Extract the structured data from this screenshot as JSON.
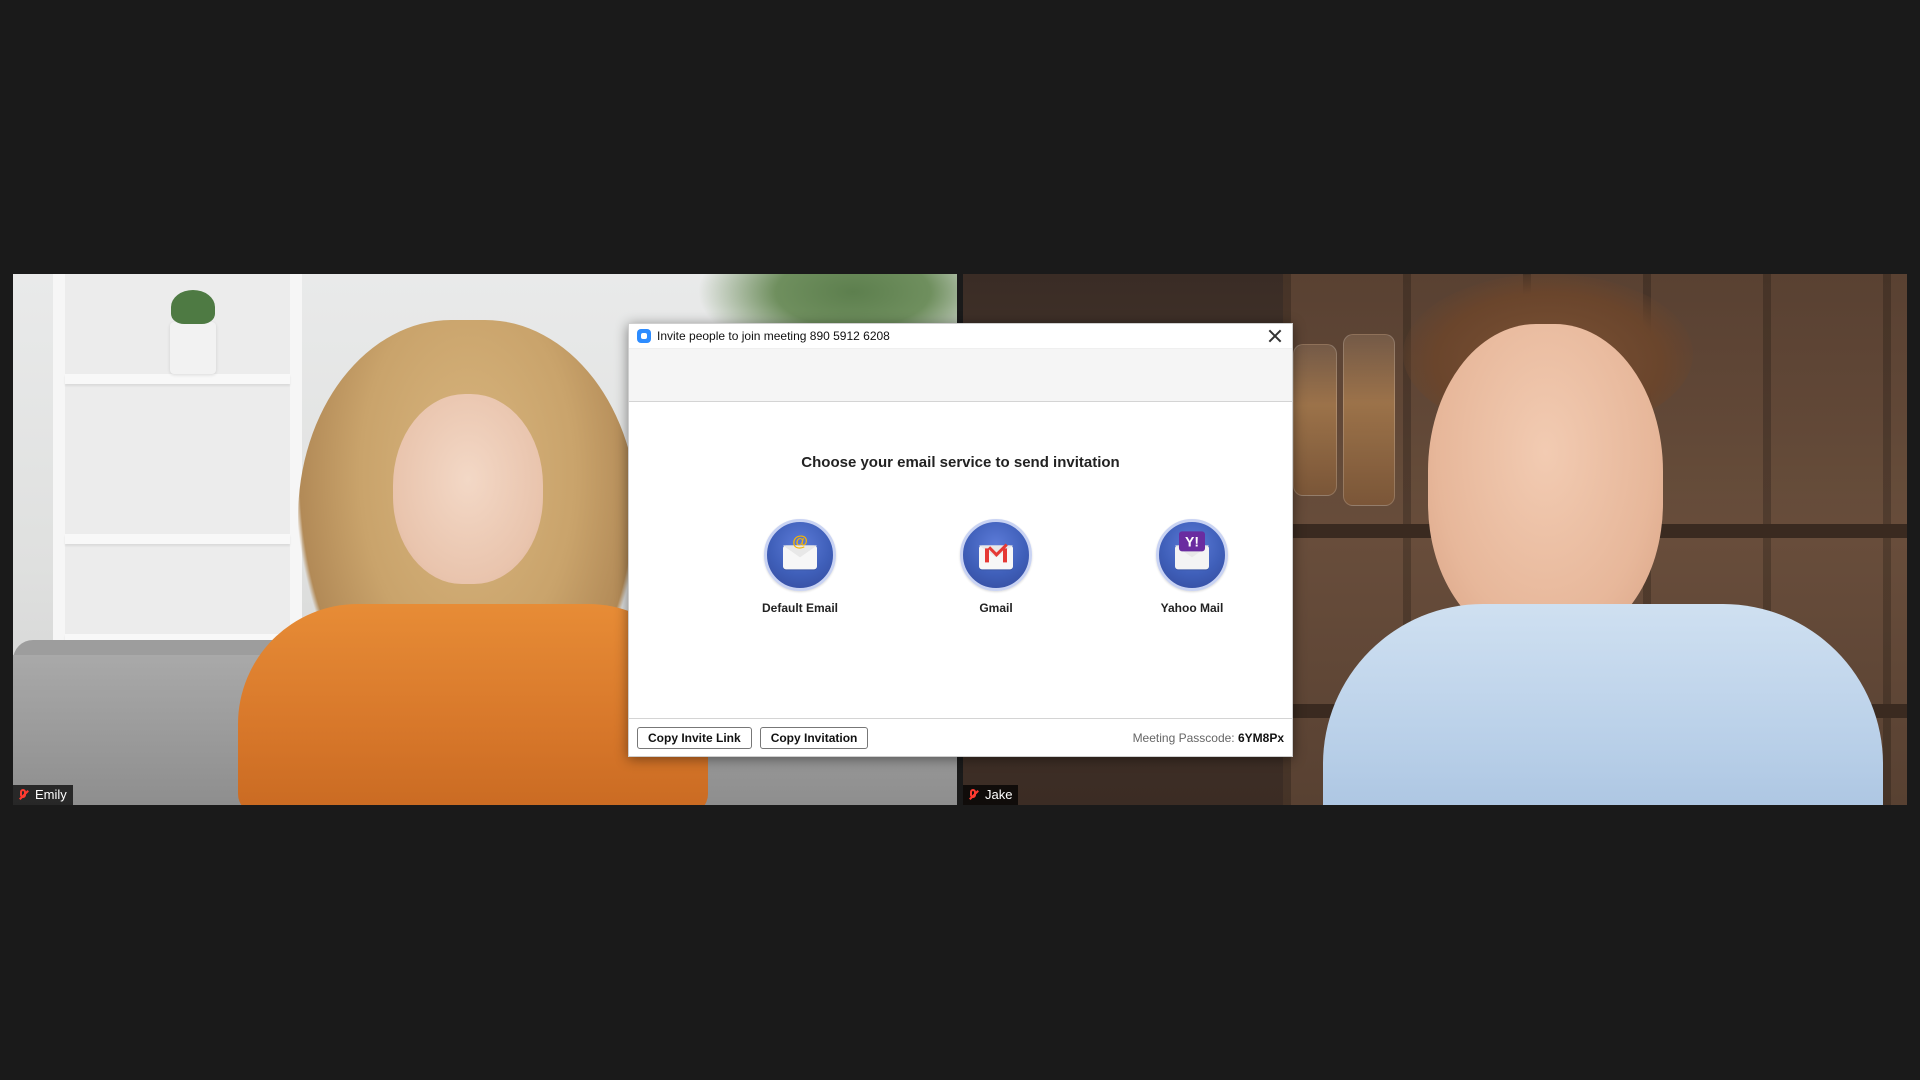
{
  "participants": [
    {
      "name": "Emily",
      "mic_state": "muted"
    },
    {
      "name": "Jake",
      "mic_state": "muted"
    }
  ],
  "dialog": {
    "title": "Invite people to join meeting 890 5912 6208",
    "headline": "Choose your email service to send invitation",
    "providers": [
      {
        "label": "Default Email",
        "icon": "email-envelope-icon"
      },
      {
        "label": "Gmail",
        "icon": "gmail-icon"
      },
      {
        "label": "Yahoo Mail",
        "icon": "yahoo-mail-icon"
      }
    ],
    "footer": {
      "copy_invite_link_label": "Copy Invite Link",
      "copy_invitation_label": "Copy Invitation",
      "passcode_label": "Meeting Passcode:",
      "passcode_value": "6YM8Px"
    }
  },
  "colors": {
    "page_background": "#1a1a1a",
    "dialog_background": "#ffffff",
    "provider_circle": "#3f5fb9",
    "muted_mic_red": "#ff3b30"
  }
}
